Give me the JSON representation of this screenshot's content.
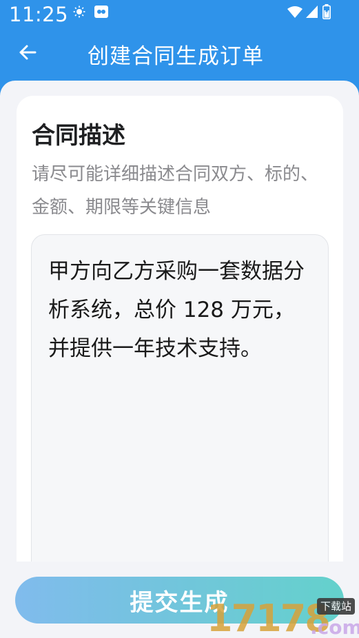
{
  "status_bar": {
    "time": "11:25",
    "icons": [
      "brightness-icon",
      "app-notification-icon",
      "wifi-icon",
      "cell-signal-icon",
      "battery-icon"
    ]
  },
  "app_bar": {
    "title": "创建合同生成订单",
    "back_icon": "arrow-left-icon"
  },
  "form": {
    "section_title": "合同描述",
    "hint": "请尽可能详细描述合同双方、标的、金额、期限等关键信息",
    "description_value": "甲方向乙方采购一套数据分析系统，总价 128 万元，并提供一年技术支持。"
  },
  "actions": {
    "submit_label": "提交生成"
  },
  "watermark": {
    "number": "17178",
    "domain": ".com",
    "tag": "下载站"
  },
  "colors": {
    "primary": "#2f93ea",
    "background": "#f3f4f8",
    "button_gradient_start": "#7ab8ec",
    "button_gradient_end": "#5ccfc9"
  }
}
